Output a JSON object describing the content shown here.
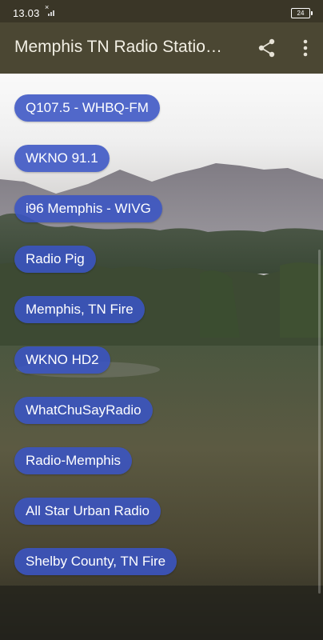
{
  "status_bar": {
    "time": "13.03",
    "battery": "24"
  },
  "app_bar": {
    "title": "Memphis TN Radio Statio…",
    "share_icon": "share-icon",
    "more_icon": "more-vert-icon"
  },
  "stations": [
    {
      "label": "Q107.5 - WHBQ-FM"
    },
    {
      "label": "WKNO 91.1"
    },
    {
      "label": "i96 Memphis - WIVG"
    },
    {
      "label": "Radio Pig"
    },
    {
      "label": "Memphis, TN Fire"
    },
    {
      "label": "WKNO HD2"
    },
    {
      "label": "WhatChuSayRadio"
    },
    {
      "label": "Radio-Memphis"
    },
    {
      "label": "All Star Urban Radio"
    },
    {
      "label": "Shelby County, TN Fire"
    }
  ],
  "colors": {
    "status_bar": "#3a3627",
    "app_bar": "#4b4733",
    "station_button": "#3a54c4"
  }
}
